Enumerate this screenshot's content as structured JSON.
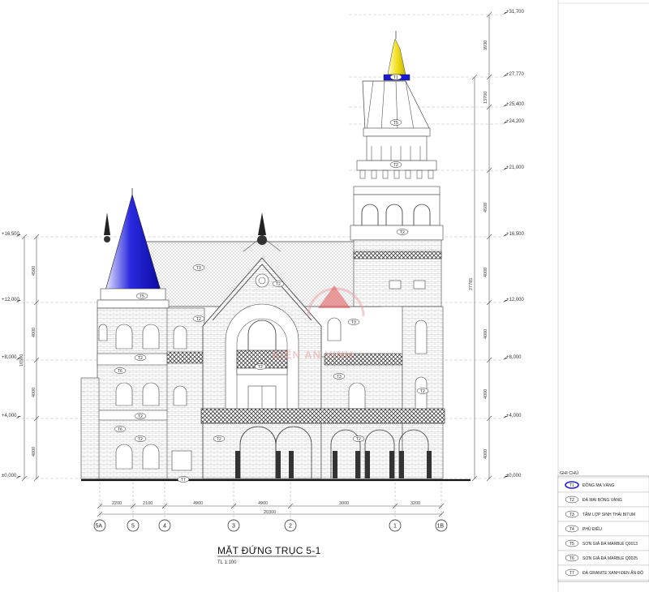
{
  "title": "MẶT ĐỨNG TRỤC 5-1",
  "scale": "TL 1:100",
  "watermark": "KIẾN AN VINH",
  "levels": [
    "+31,700",
    "+27,770",
    "+25,400",
    "+24,200",
    "+21,000",
    "+16,500",
    "+12,000",
    "+8,000",
    "+4,000",
    "±0,000"
  ],
  "levels_left": [
    "+16,500",
    "+12,000",
    "+8,000",
    "+4,000",
    "±0,000"
  ],
  "dims_right": [
    "3930",
    "13700",
    "4500",
    "4000",
    "4000",
    "4000",
    "4000"
  ],
  "dims_right_total": "27785",
  "dims_left": [
    "4500",
    "4000",
    "4000",
    "4000"
  ],
  "dims_left_total": "16500",
  "dims_bottom": [
    "2200",
    "2100",
    "4900",
    "4900",
    "3000",
    "3200"
  ],
  "dims_bottom_total": "20300",
  "axes": [
    "5A",
    "5",
    "4",
    "3",
    "2",
    "1",
    "1B"
  ],
  "tags": [
    "T1",
    "T5",
    "T2",
    "T2",
    "T5",
    "T3",
    "T2",
    "T2",
    "T3",
    "T2",
    "T6",
    "T2",
    "T6",
    "T2",
    "T7",
    "T3",
    "T2",
    "T2",
    "T2",
    "T2"
  ],
  "legend": {
    "title": "GHI CHÚ",
    "items": [
      {
        "code": "T1",
        "label": "ĐỒNG MẠ VÀNG"
      },
      {
        "code": "T2",
        "label": "ĐÁ MÀI BÓNG VÀNG"
      },
      {
        "code": "T3",
        "label": "TẤM LỢP SINH THÁI BITUM"
      },
      {
        "code": "T4",
        "label": "PHÙ ĐIÊU"
      },
      {
        "code": "T5",
        "label": "SƠN GIẢ ĐÁ MARBLE Q0013"
      },
      {
        "code": "T6",
        "label": "SƠN GIẢ ĐÁ MARBLE Q0025"
      },
      {
        "code": "T7",
        "label": "ĐÁ GRANITE XANH ĐEN ẤN ĐỘ"
      }
    ]
  },
  "colors": {
    "tower_cap": "#f0e030",
    "spire_blue": "#1a1ad8",
    "line": "#444444",
    "watermark": "#e8a0a0"
  }
}
